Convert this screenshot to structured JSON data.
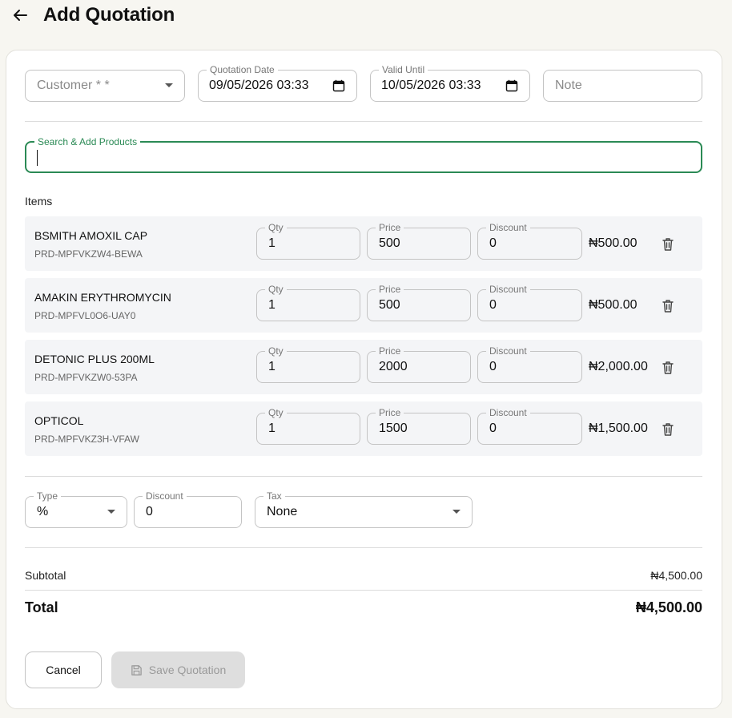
{
  "header": {
    "title": "Add Quotation"
  },
  "form": {
    "customer": {
      "placeholder": "Customer * *"
    },
    "quotation_date": {
      "label": "Quotation Date",
      "value": "09/05/2026 03:33"
    },
    "valid_until": {
      "label": "Valid Until",
      "value": "10/05/2026 03:33"
    },
    "note": {
      "placeholder": "Note"
    },
    "search": {
      "label": "Search & Add Products",
      "value": ""
    }
  },
  "items_section": {
    "title": "Items",
    "qty_label": "Qty",
    "price_label": "Price",
    "discount_label": "Discount",
    "rows": [
      {
        "name": "BSMITH AMOXIL CAP",
        "sku": "PRD-MPFVKZW4-BEWA",
        "qty": "1",
        "price": "500",
        "discount": "0",
        "total": "₦500.00"
      },
      {
        "name": "AMAKIN ERYTHROMYCIN",
        "sku": "PRD-MPFVL0O6-UAY0",
        "qty": "1",
        "price": "500",
        "discount": "0",
        "total": "₦500.00"
      },
      {
        "name": "DETONIC PLUS 200ML",
        "sku": "PRD-MPFVKZW0-53PA",
        "qty": "1",
        "price": "2000",
        "discount": "0",
        "total": "₦2,000.00"
      },
      {
        "name": "OPTICOL",
        "sku": "PRD-MPFVKZ3H-VFAW",
        "qty": "1",
        "price": "1500",
        "discount": "0",
        "total": "₦1,500.00"
      }
    ]
  },
  "adjustments": {
    "type": {
      "label": "Type",
      "value": "%"
    },
    "discount": {
      "label": "Discount",
      "value": "0"
    },
    "tax": {
      "label": "Tax",
      "value": "None"
    }
  },
  "summary": {
    "subtotal_label": "Subtotal",
    "subtotal_value": "₦4,500.00",
    "total_label": "Total",
    "total_value": "₦4,500.00"
  },
  "actions": {
    "cancel_label": "Cancel",
    "save_label": "Save Quotation"
  },
  "colors": {
    "accent": "#2b8a55",
    "background": "#f7f6f1",
    "row_background": "#f4f5f7",
    "disabled_button": "#dedede"
  }
}
